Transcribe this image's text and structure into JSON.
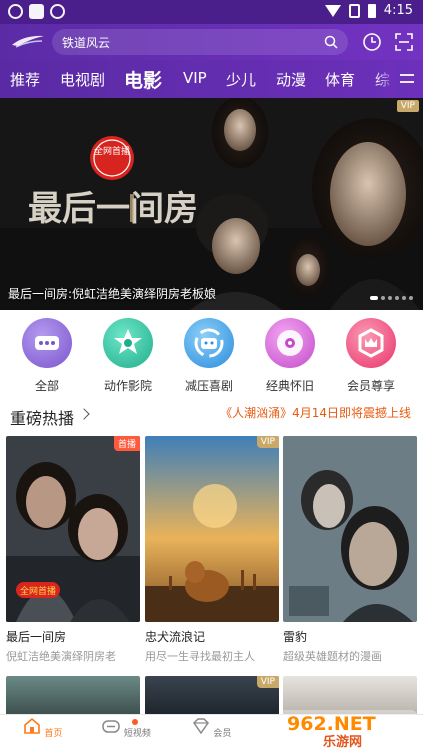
{
  "status_bar": {
    "time": "4:15"
  },
  "search": {
    "placeholder": "铁道风云"
  },
  "tabs": [
    "推荐",
    "电视剧",
    "电影",
    "VIP",
    "少儿",
    "动漫",
    "体育",
    "综"
  ],
  "active_tab": "电影",
  "banner": {
    "caption": "最后一间房:倪虹洁绝美演绎阴房老板娘",
    "badge": "VIP",
    "poster_title": "最后一间房",
    "poster_stamp": "全网首播",
    "slide_count": 6,
    "active_slide": 0
  },
  "categories": [
    {
      "label": "全部",
      "icon": "more-dots-icon",
      "color": "#8a63d2"
    },
    {
      "label": "动作影院",
      "icon": "film-star-icon",
      "color": "#2ec4a2"
    },
    {
      "label": "减压喜剧",
      "icon": "smile-face-icon",
      "color": "#3aa0e8"
    },
    {
      "label": "经典怀旧",
      "icon": "disc-icon",
      "color": "#d65bd6"
    },
    {
      "label": "会员尊享",
      "icon": "crown-icon",
      "color": "#ef4b7a"
    }
  ],
  "section": {
    "title": "重磅热播",
    "promo": "《人潮汹涌》4月14日即将震撼上线"
  },
  "posters": [
    {
      "title": "最后一间房",
      "subtitle": "倪虹洁绝美演绎阴房老",
      "tag": "首播",
      "tag_type": "first",
      "stamp": "全网首播"
    },
    {
      "title": "忠犬流浪记",
      "subtitle": "用尽一生寻找最初主人",
      "tag": "VIP",
      "tag_type": "vip"
    },
    {
      "title": "雷豹",
      "subtitle": "超级英雄题材的漫画",
      "tag": "",
      "tag_type": ""
    }
  ],
  "row2": [
    {
      "tag": ""
    },
    {
      "tag": "VIP"
    },
    {
      "tag": ""
    }
  ],
  "bottom_nav": [
    {
      "label": "首页",
      "icon": "home-icon",
      "active": true
    },
    {
      "label": "短视频",
      "icon": "short-video-icon",
      "active": false
    },
    {
      "label": "会员",
      "icon": "vip-diamond-icon",
      "active": false
    }
  ],
  "watermark": {
    "text": "962.NET",
    "subtext": "乐游网"
  },
  "colors": {
    "brand": "#6a2fb8",
    "accent": "#ff7a1a",
    "promo": "#e85a10"
  }
}
